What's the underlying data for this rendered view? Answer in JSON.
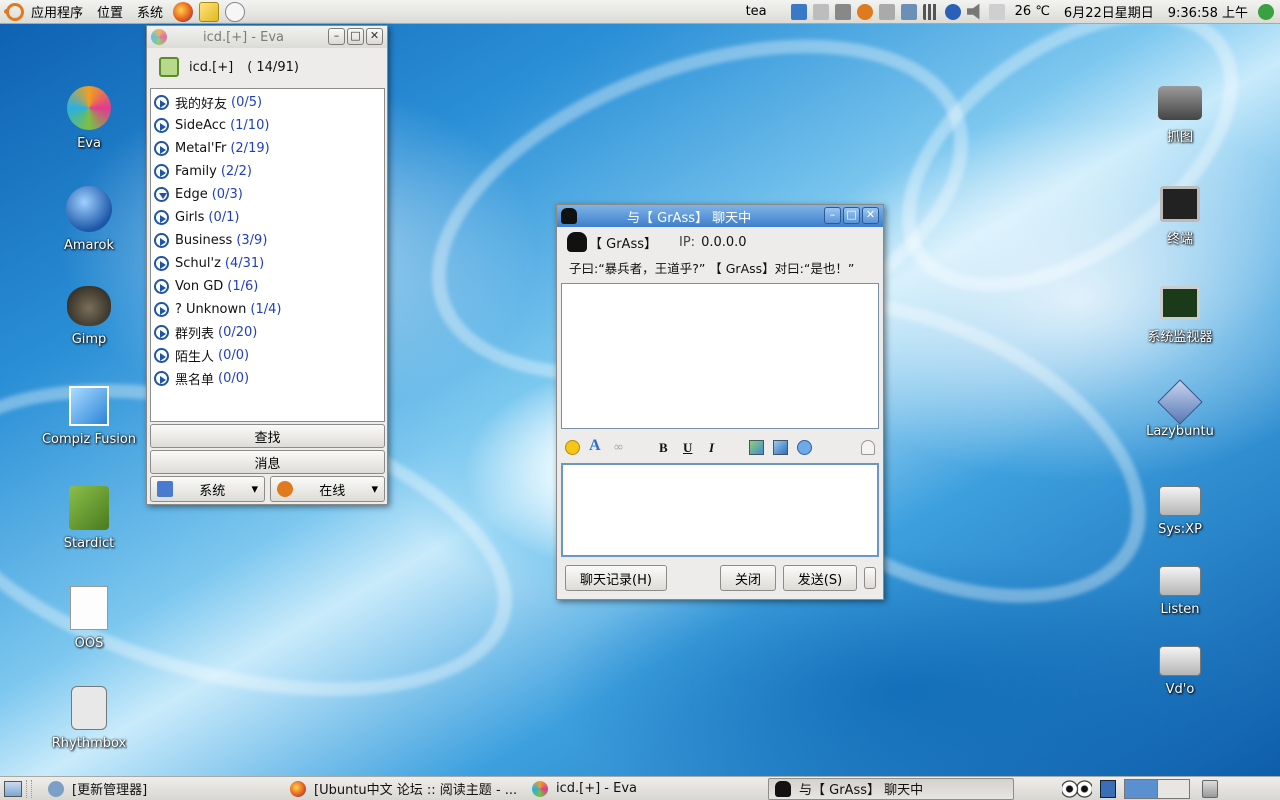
{
  "top_panel": {
    "applications": "应用程序",
    "places": "位置",
    "system": "系统",
    "user": "tea",
    "temperature": "26 ℃",
    "date": "6月22日星期日",
    "time": "9:36:58 上午"
  },
  "desktop_icons": {
    "left": [
      "Eva",
      "Amarok",
      "Gimp",
      "Compiz Fusion",
      "Stardict",
      "OOS",
      "Rhythmbox"
    ],
    "right": [
      "抓图",
      "终端",
      "系统监视器",
      "Lazybuntu",
      "Sys:XP",
      "Listen",
      "Vd'o"
    ]
  },
  "eva": {
    "title": "icd.[+] - Eva",
    "account": "icd.[+]",
    "online_count": "( 14/91)",
    "groups": [
      {
        "name": "我的好友",
        "count": "(0/5)"
      },
      {
        "name": "SideAcc",
        "count": "(1/10)"
      },
      {
        "name": "Metal'Fr",
        "count": "(2/19)"
      },
      {
        "name": "Family",
        "count": "(2/2)"
      },
      {
        "name": "Edge",
        "count": "(0/3)"
      },
      {
        "name": "Girls",
        "count": "(0/1)"
      },
      {
        "name": "Business",
        "count": "(3/9)"
      },
      {
        "name": "Schul'z",
        "count": "(4/31)"
      },
      {
        "name": "Von GD",
        "count": "(1/6)"
      },
      {
        "name": "? Unknown",
        "count": "(1/4)"
      },
      {
        "name": "群列表",
        "count": "(0/20)"
      },
      {
        "name": "陌生人",
        "count": "(0/0)"
      },
      {
        "name": "黑名单",
        "count": "(0/0)"
      }
    ],
    "find_button": "查找",
    "message_button": "消息",
    "system_menu": "系统",
    "status_menu": "在线"
  },
  "chat": {
    "title": "与【 GrAss】 聊天中",
    "contact": "【 GrAss】",
    "ip_label": "IP:",
    "ip": "0.0.0.0",
    "signature": "子曰:“暴兵者，王道乎?” 【 GrAss】对曰:“是也！”",
    "format_buttons": {
      "bold": "B",
      "underline": "U",
      "italic": "I"
    },
    "history_button": "聊天记录(H)",
    "close_button": "关闭",
    "send_button": "发送(S)"
  },
  "taskbar": {
    "tasks": [
      "[更新管理器]",
      "[Ubuntu中文 论坛 :: 阅读主题 - ...",
      "icd.[+] - Eva",
      "与【 GrAss】 聊天中"
    ]
  },
  "colors": {
    "accent": "#3d7fcc",
    "count_blue": "#1f3fbf"
  }
}
